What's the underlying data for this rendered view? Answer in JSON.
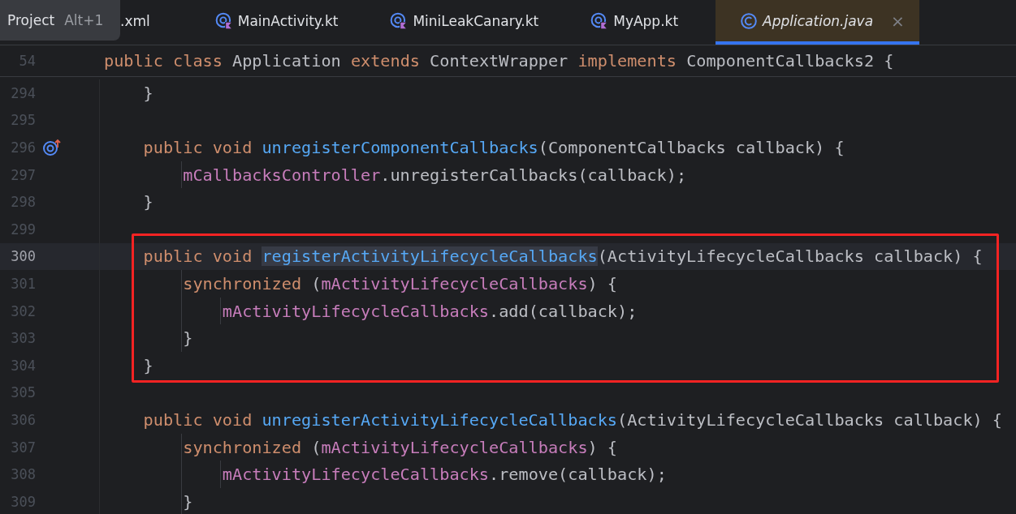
{
  "tooltip": {
    "label": "Project",
    "shortcut": "Alt+1"
  },
  "tabs": [
    {
      "label": ".xml",
      "kind": "covered",
      "selected": false
    },
    {
      "label": "MainActivity.kt",
      "kind": "kotlin",
      "selected": false
    },
    {
      "label": "MiniLeakCanary.kt",
      "kind": "kotlin",
      "selected": false
    },
    {
      "label": "MyApp.kt",
      "kind": "kotlin",
      "selected": false
    },
    {
      "label": "Application.java",
      "kind": "java",
      "selected": true,
      "close": "×"
    }
  ],
  "sticky_line": {
    "number": "54",
    "tokens": [
      {
        "kind": "keyword",
        "text": "public class "
      },
      {
        "kind": "plain",
        "text": "Application "
      },
      {
        "kind": "keyword",
        "text": "extends "
      },
      {
        "kind": "plain",
        "text": "ContextWrapper "
      },
      {
        "kind": "keyword",
        "text": "implements "
      },
      {
        "kind": "plain",
        "text": "ComponentCallbacks2 {"
      }
    ]
  },
  "blocks": [
    {
      "kind": "plain",
      "lines": [
        {
          "number": "294",
          "kind": "code",
          "current": false,
          "tokens": [
            {
              "kind": "plain",
              "text": "    }"
            }
          ]
        },
        {
          "number": "295",
          "kind": "code",
          "current": false
        },
        {
          "number": "296",
          "kind": "implementing",
          "current": false,
          "tokens": [
            {
              "kind": "keyword",
              "text": "    public void "
            },
            {
              "kind": "method",
              "text": "unregisterComponentCallbacks"
            },
            {
              "kind": "plain",
              "text": "(ComponentCallbacks callback) {"
            }
          ]
        },
        {
          "number": "297",
          "kind": "code",
          "current": false,
          "tokens": [
            {
              "kind": "field",
              "text": "        mCallbacksController"
            },
            {
              "kind": "plain",
              "text": ".unregisterCallbacks(callback);"
            }
          ]
        },
        {
          "number": "298",
          "kind": "code",
          "current": false,
          "tokens": [
            {
              "kind": "plain",
              "text": "    }"
            }
          ]
        },
        {
          "number": "299",
          "kind": "code",
          "current": false
        }
      ]
    },
    {
      "kind": "framed",
      "lines": [
        {
          "number": "300",
          "kind": "code",
          "current": true,
          "tokens": [
            {
              "kind": "keyword",
              "text": "    public void "
            },
            {
              "kind": "usage",
              "text": "registerActivityLifecycleCallbacks"
            },
            {
              "kind": "plain",
              "text": "(ActivityLifecycleCallbacks callback) {"
            }
          ]
        },
        {
          "number": "301",
          "kind": "code",
          "current": false,
          "tokens": [
            {
              "kind": "keyword",
              "text": "        synchronized "
            },
            {
              "kind": "plain",
              "text": "("
            },
            {
              "kind": "field",
              "text": "mActivityLifecycleCallbacks"
            },
            {
              "kind": "plain",
              "text": ") {"
            }
          ]
        },
        {
          "number": "302",
          "kind": "code",
          "current": false,
          "tokens": [
            {
              "kind": "field",
              "text": "            mActivityLifecycleCallbacks"
            },
            {
              "kind": "plain",
              "text": ".add(callback);"
            }
          ]
        },
        {
          "number": "303",
          "kind": "code",
          "current": false,
          "tokens": [
            {
              "kind": "plain",
              "text": "        }"
            }
          ]
        },
        {
          "number": "304",
          "kind": "code",
          "current": false,
          "tokens": [
            {
              "kind": "plain",
              "text": "    }"
            }
          ]
        }
      ]
    },
    {
      "kind": "plain",
      "lines": [
        {
          "number": "305",
          "kind": "code",
          "current": false
        },
        {
          "number": "306",
          "kind": "code",
          "current": false,
          "tokens": [
            {
              "kind": "keyword",
              "text": "    public void "
            },
            {
              "kind": "method",
              "text": "unregisterActivityLifecycleCallbacks"
            },
            {
              "kind": "plain",
              "text": "(ActivityLifecycleCallbacks callback) {"
            }
          ]
        },
        {
          "number": "307",
          "kind": "code",
          "current": false,
          "tokens": [
            {
              "kind": "keyword",
              "text": "        synchronized "
            },
            {
              "kind": "plain",
              "text": "("
            },
            {
              "kind": "field",
              "text": "mActivityLifecycleCallbacks"
            },
            {
              "kind": "plain",
              "text": ") {"
            }
          ]
        },
        {
          "number": "308",
          "kind": "code",
          "current": false,
          "tokens": [
            {
              "kind": "field",
              "text": "            mActivityLifecycleCallbacks"
            },
            {
              "kind": "plain",
              "text": ".remove(callback);"
            }
          ]
        },
        {
          "number": "309",
          "kind": "code",
          "current": false,
          "tokens": [
            {
              "kind": "plain",
              "text": "        }"
            }
          ]
        }
      ]
    }
  ]
}
